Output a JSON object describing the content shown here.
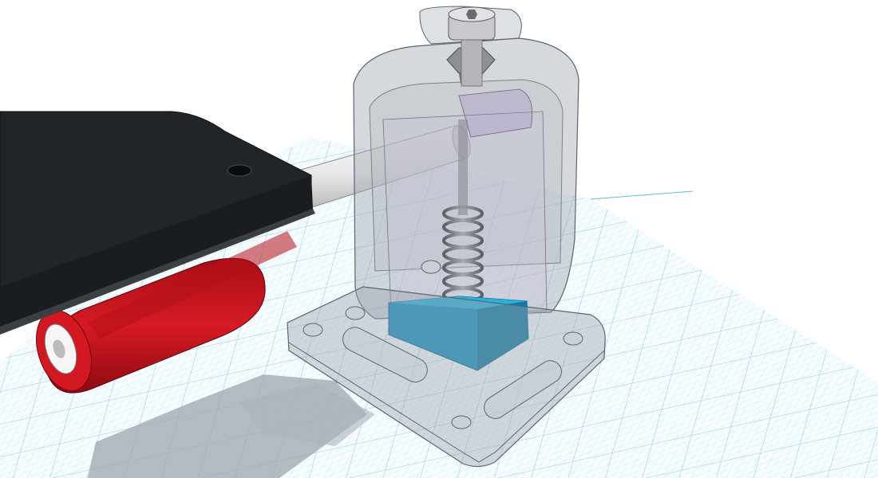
{
  "app": {
    "view": "3d-workplane",
    "icons": {
      "workplane": "grid-workplane",
      "bolt_head": "hex-socket-bolt-icon"
    }
  },
  "scene": {
    "objects": [
      {
        "name": "workplane-grid",
        "color": "#5bbcdc"
      },
      {
        "name": "shadow",
        "color": "#9ea6ae"
      },
      {
        "name": "black-arm-plate",
        "color": "#212529"
      },
      {
        "name": "red-roller",
        "color": "#c8141e"
      },
      {
        "name": "white-shaft",
        "color": "#ebebeb"
      },
      {
        "name": "transparent-housing",
        "color": "#9aa3ab"
      },
      {
        "name": "base-plate",
        "color": "#9aa3ab"
      },
      {
        "name": "spring",
        "color": "#7e7e88"
      },
      {
        "name": "blue-block",
        "color": "#1891c0"
      },
      {
        "name": "hex-nut",
        "color": "#8f8f96"
      },
      {
        "name": "socket-bolt",
        "color": "#c9c9cd"
      }
    ]
  }
}
